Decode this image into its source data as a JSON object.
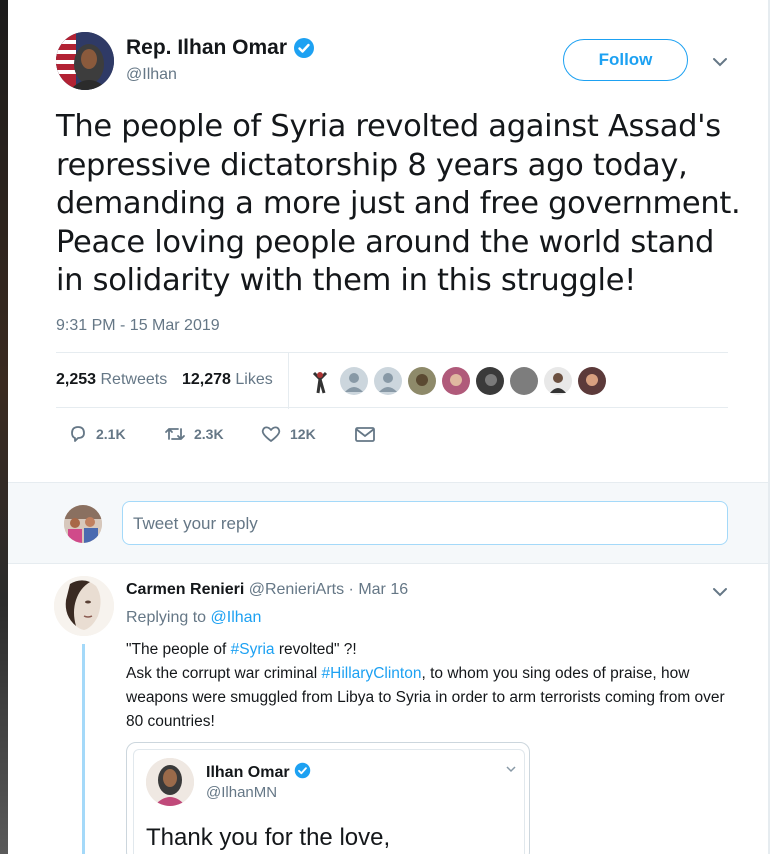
{
  "tweet": {
    "display_name": "Rep. Ilhan Omar",
    "handle": "@Ilhan",
    "follow_label": "Follow",
    "text": "The people of Syria revolted against Assad's repressive dictatorship 8 years ago today, demanding a more just and free government. Peace loving people around the world stand in solidarity with them in this struggle!",
    "timestamp": "9:31 PM - 15 Mar 2019",
    "stats": {
      "retweets_count": "2,253",
      "retweets_label": "Retweets",
      "likes_count": "12,278",
      "likes_label": "Likes"
    },
    "actions": {
      "replies": "2.1K",
      "retweets": "2.3K",
      "likes": "12K"
    }
  },
  "reply_box": {
    "placeholder": "Tweet your reply"
  },
  "reply": {
    "name": "Carmen Renieri",
    "handle": "@RenieriArts",
    "separator": "·",
    "date": "Mar 16",
    "replying_prefix": "Replying to",
    "replying_to": "@Ilhan",
    "line1_before": "\"The people of ",
    "line1_hashtag": "#Syria",
    "line1_after": " revolted\" ?!",
    "line2_before": "Ask the corrupt war criminal ",
    "line2_hashtag": "#HillaryClinton",
    "line2_after": ", to whom you sing odes of praise, how weapons were smuggled from Libya to Syria in order to arm terrorists coming from over 80 countries!",
    "quote": {
      "name": "Ilhan Omar",
      "handle": "@IlhanMN",
      "text": "Thank you for the love,"
    }
  },
  "colors": {
    "accent": "#1da1f2",
    "text": "#14171a",
    "secondary_text": "#657786",
    "border": "#e6ecf0"
  },
  "icons": [
    "verified-badge-icon",
    "chevron-down-icon",
    "reply-icon",
    "retweet-icon",
    "like-heart-icon",
    "direct-message-icon"
  ]
}
